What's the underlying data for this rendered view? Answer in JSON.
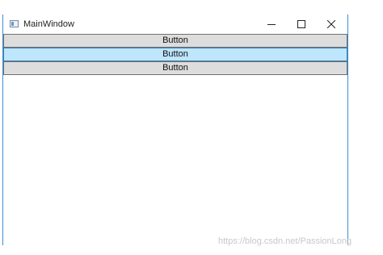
{
  "window": {
    "title": "MainWindow"
  },
  "buttons": [
    {
      "label": "Button",
      "state": "normal"
    },
    {
      "label": "Button",
      "state": "hover"
    },
    {
      "label": "Button",
      "state": "normal"
    }
  ],
  "watermark": "https://blog.csdn.net/PassionLong",
  "colors": {
    "window_border": "#3c8fd6",
    "button_bg": "#dddddd",
    "button_hover_bg": "#bee6fd",
    "button_hover_border": "#3c7fb1"
  }
}
